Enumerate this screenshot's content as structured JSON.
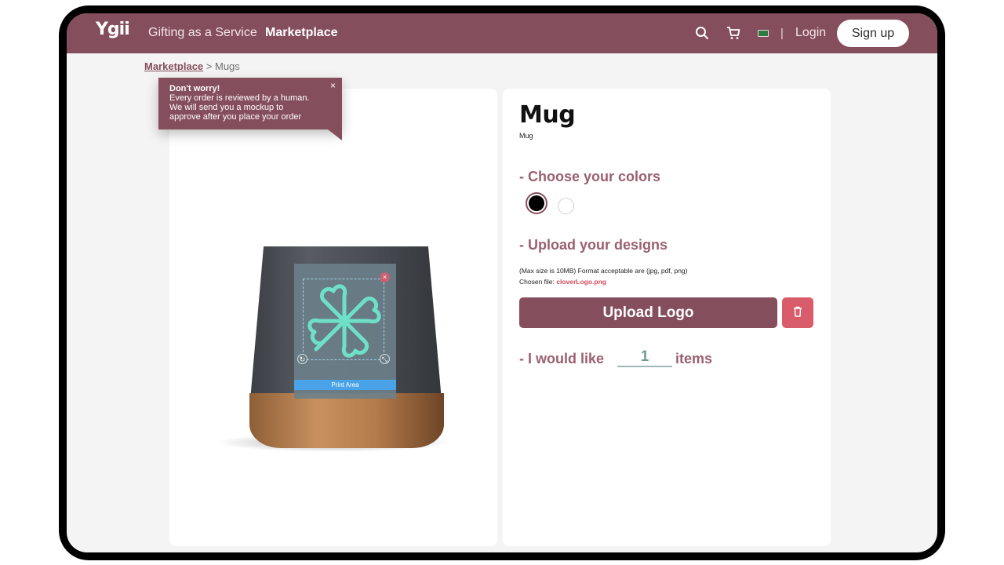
{
  "navbar": {
    "logo": "Ygii",
    "links": [
      "Gifting as a Service",
      "Marketplace"
    ],
    "active": "Marketplace",
    "icons": [
      "search-icon",
      "cart-icon",
      "flag-icon"
    ],
    "separator": "|",
    "login": "Login",
    "signup": "Sign up",
    "color": "#854e5c"
  },
  "breadcrumb": {
    "link": "Marketplace",
    "separator": " > ",
    "current": "Mugs"
  },
  "tooltip": {
    "title": "Don't worry!",
    "lines": [
      "Every order is reviewed by a human.",
      "We will send you a mockup to",
      "approve after you place your order"
    ],
    "close": "×"
  },
  "preview": {
    "print_area_label": "Print Area",
    "design_icon": "clover-logo"
  },
  "product": {
    "title": "Mug",
    "subtitle": "Mug"
  },
  "colors": {
    "heading": "- Choose your colors",
    "options": [
      "#000000",
      "#ffffff"
    ],
    "selected": "#000000"
  },
  "designs": {
    "heading": "- Upload your designs",
    "hint": "(Max size is 10MB) Format acceptable are (jpg, pdf, png)",
    "chosen_label": "Chosen file: ",
    "chosen_file": "cloverLogo.png",
    "upload_label": "Upload Logo",
    "delete_icon": "trash-icon"
  },
  "quantity": {
    "prefix": "- I would like",
    "value": "1",
    "suffix": "items"
  }
}
